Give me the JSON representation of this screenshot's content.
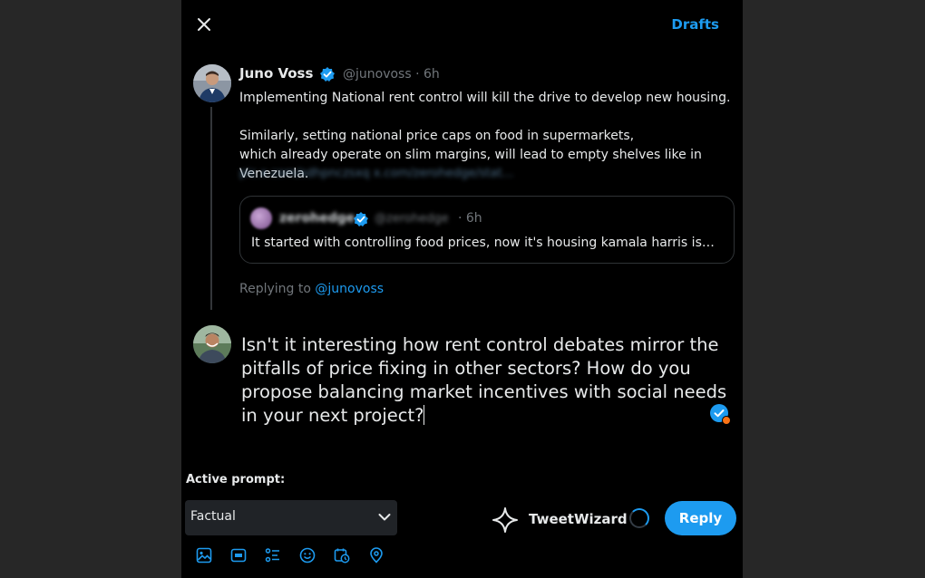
{
  "header": {
    "close_icon": "close-icon",
    "drafts_label": "Drafts"
  },
  "original_post": {
    "author_name": "Juno Voss",
    "handle_time": "@junovoss · 6h",
    "verified_icon": "verified-badge-icon",
    "text_line_1": "Implementing National rent control will kill the drive to develop new housing.",
    "text_line_2": "Similarly, setting national price caps on food in supermarkets,",
    "text_line_3": "which already operate on slim margins, will lead to empty shelves like in Venezuela.",
    "link_text": "pic.x.com/sdhpnczsxq x.com/zerohedge/stat…",
    "quoted_post": {
      "author_name": "zerohedge",
      "handle": "@zerohedge",
      "time": "· 6h",
      "text": "It started with controlling food prices, now it's housing kamala harris is…"
    },
    "replying_prefix": "Replying to ",
    "replying_mention": "@junovoss"
  },
  "compose": {
    "text": "Isn't it interesting how rent control debates mirror the pitfalls of price fixing in other sectors? How do you propose balancing market incentives with social needs in your next project?"
  },
  "prompt": {
    "label": "Active prompt:",
    "selected": "Factual"
  },
  "toolbar": {
    "icons": [
      "image-icon",
      "gif-icon",
      "poll-icon",
      "emoji-icon",
      "schedule-icon",
      "location-icon"
    ]
  },
  "actions": {
    "wizard_label": "TweetWizard",
    "reply_label": "Reply"
  },
  "colors": {
    "accent": "#1d9bf0",
    "background": "#000000",
    "text": "#e7e9ea",
    "muted": "#71767b"
  }
}
